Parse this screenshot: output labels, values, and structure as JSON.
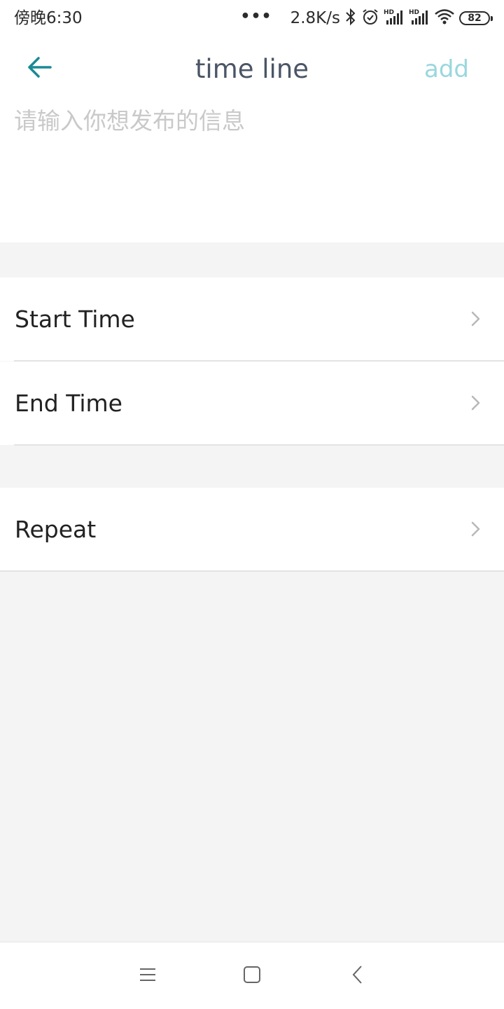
{
  "status_bar": {
    "time": "傍晚6:30",
    "dots": "•••",
    "net_speed": "2.8K/s",
    "battery": "82",
    "icons": [
      "bluetooth-icon",
      "alarm-icon",
      "hd-signal-icon",
      "hd-signal-icon",
      "wifi-icon",
      "battery-icon"
    ]
  },
  "header": {
    "title": "time line",
    "add_label": "add",
    "back_icon": "arrow-left-icon",
    "colors": {
      "back_arrow": "#1a8a95",
      "title": "#4a5566",
      "add": "#9ad7de"
    }
  },
  "compose": {
    "placeholder": "请输入你想发布的信息",
    "value": ""
  },
  "settings": {
    "start_time": "Start Time",
    "end_time": "End Time",
    "repeat": "Repeat"
  },
  "nav_bar": {
    "icons": [
      "menu-icon",
      "home-icon",
      "back-icon"
    ]
  }
}
